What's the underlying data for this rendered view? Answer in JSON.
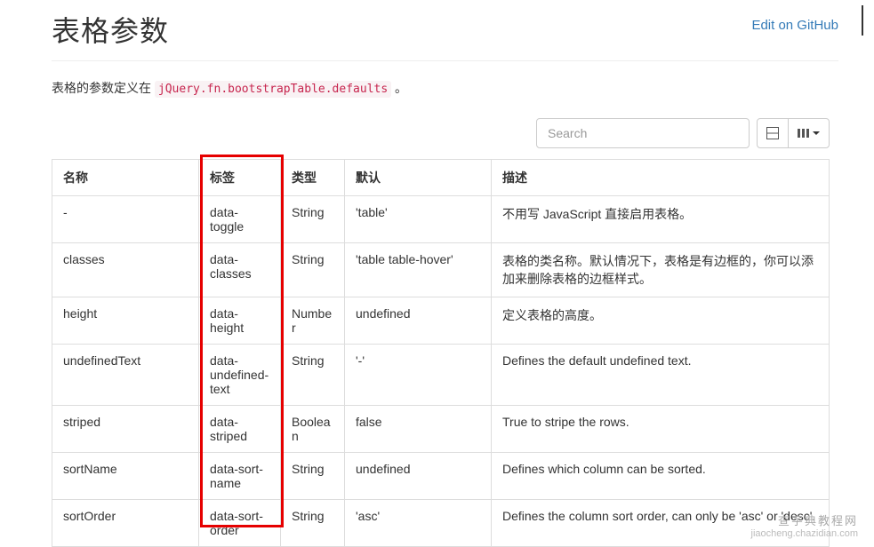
{
  "header": {
    "title": "表格参数",
    "edit_link": "Edit on GitHub"
  },
  "intro": {
    "prefix": "表格的参数定义在 ",
    "code": "jQuery.fn.bootstrapTable.defaults",
    "suffix": " 。"
  },
  "toolbar": {
    "search_placeholder": "Search"
  },
  "table": {
    "headers": {
      "name": "名称",
      "tag": "标签",
      "type": "类型",
      "default": "默认",
      "desc": "描述"
    },
    "rows": [
      {
        "name": "-",
        "tag": "data-toggle",
        "type": "String",
        "default": "'table'",
        "desc": "不用写 JavaScript 直接启用表格。"
      },
      {
        "name": "classes",
        "tag": "data-classes",
        "type": "String",
        "default": "'table table-hover'",
        "desc": "表格的类名称。默认情况下，表格是有边框的，你可以添加来删除表格的边框样式。"
      },
      {
        "name": "height",
        "tag": "data-height",
        "type": "Number",
        "default": "undefined",
        "desc": "定义表格的高度。"
      },
      {
        "name": "undefinedText",
        "tag": "data-undefined-text",
        "type": "String",
        "default": "'-'",
        "desc": "Defines the default undefined text."
      },
      {
        "name": "striped",
        "tag": "data-striped",
        "type": "Boolean",
        "default": "false",
        "desc": "True to stripe the rows."
      },
      {
        "name": "sortName",
        "tag": "data-sort-name",
        "type": "String",
        "default": "undefined",
        "desc": "Defines which column can be sorted."
      },
      {
        "name": "sortOrder",
        "tag": "data-sort-order",
        "type": "String",
        "default": "'asc'",
        "desc": "Defines the column sort order, can only be 'asc' or 'desc'."
      }
    ]
  },
  "watermark": {
    "line1": "查字典教程网",
    "line2": "jiaocheng.chazidian.com"
  }
}
